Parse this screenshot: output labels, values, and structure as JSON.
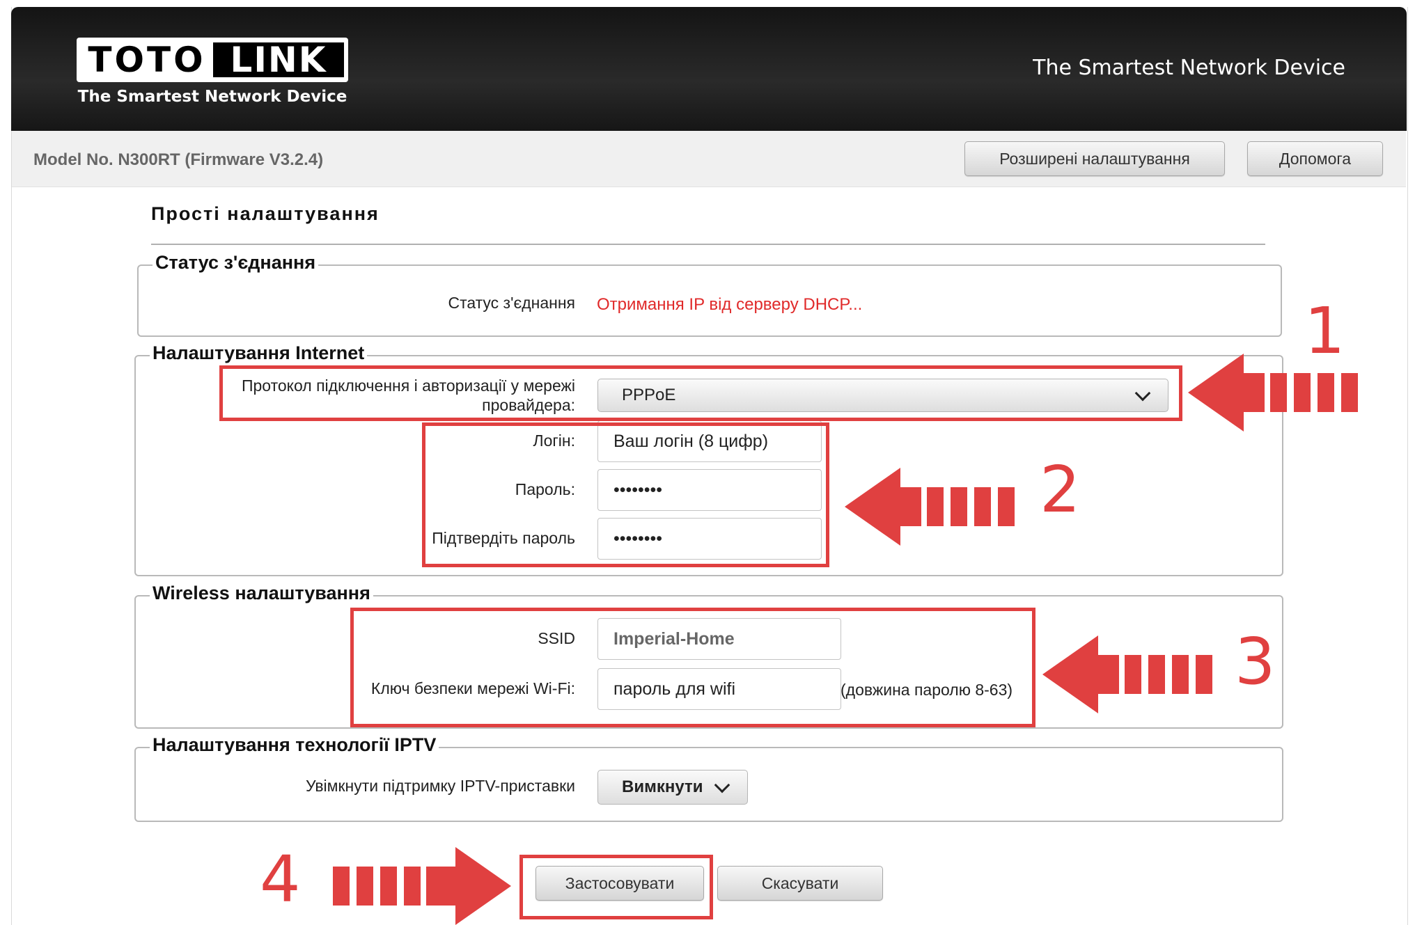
{
  "header": {
    "logo_left": "TOTO",
    "logo_right": "LINK",
    "logo_tagline": "The Smartest Network Device",
    "tagline": "The Smartest Network Device"
  },
  "toolbar": {
    "model": "Model No. N300RT (Firmware V3.2.4)",
    "advanced_label": "Розширені налаштування",
    "help_label": "Допомога"
  },
  "page": {
    "title": "Прості налаштування"
  },
  "connection_status": {
    "legend": "Статус з'єднання",
    "label": "Статус з'єднання",
    "value": "Отримання IP від серверу DHCP..."
  },
  "internet": {
    "legend": "Налаштування Internet",
    "protocol_label_line1": "Протокол підключення і авторизації у мережі",
    "protocol_label_line2": "провайдера:",
    "protocol_value": "PPPoE",
    "login_label": "Логін:",
    "login_value": "Ваш логін (8 цифр)",
    "password_label": "Пароль:",
    "password_value": "••••••••",
    "confirm_label": "Підтвердіть пароль",
    "confirm_value": "••••••••"
  },
  "wireless": {
    "legend": "Wireless налаштування",
    "ssid_label": "SSID",
    "ssid_value": "Imperial-Home",
    "key_label": "Ключ безпеки мережі Wi-Fi:",
    "key_value": "пароль для wifi",
    "key_hint": "(довжина паролю 8-63)"
  },
  "iptv": {
    "legend": "Налаштування технології IPTV",
    "label": "Увімкнути підтримку IPTV-приставки",
    "value": "Вимкнути"
  },
  "actions": {
    "apply_label": "Застосовувати",
    "cancel_label": "Скасувати"
  },
  "annotations": {
    "step1": "1",
    "step2": "2",
    "step3": "3",
    "step4": "4",
    "color": "#e04040"
  }
}
